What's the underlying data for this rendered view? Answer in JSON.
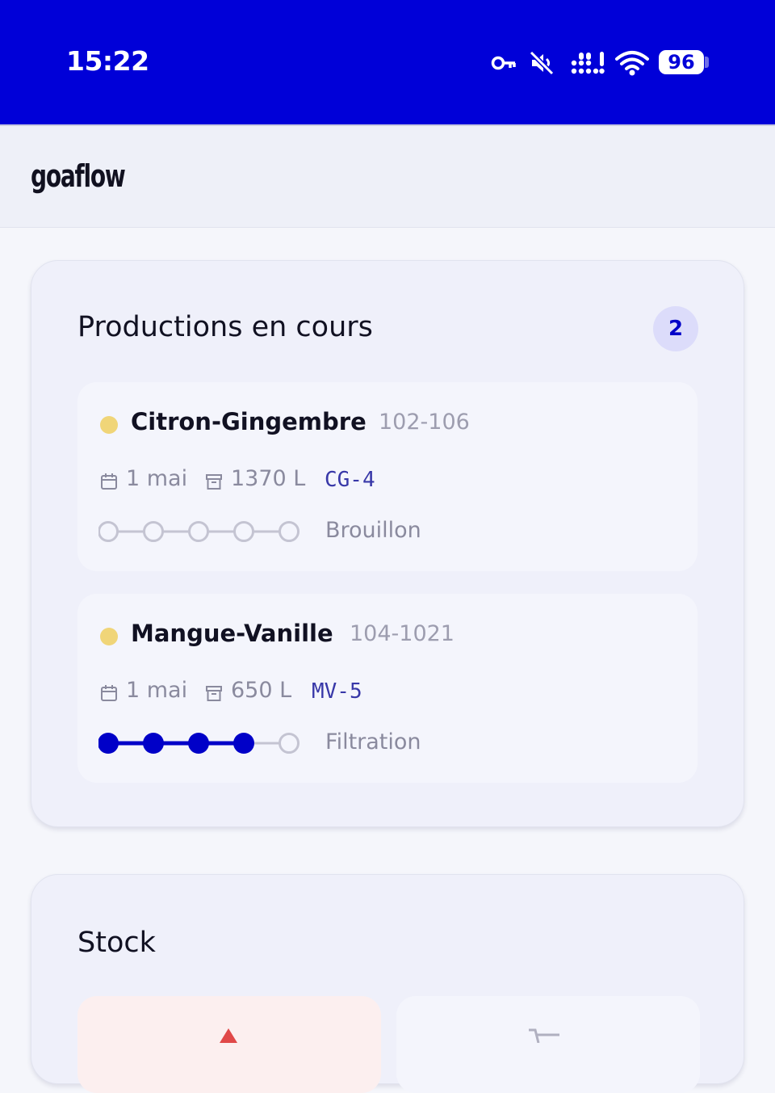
{
  "status_bar": {
    "time": "15:22",
    "battery": "96",
    "icons": [
      "vpn-key-icon",
      "mute-icon",
      "signal-icon",
      "wifi-icon",
      "battery-icon"
    ]
  },
  "app": {
    "name": "goaflow"
  },
  "productions": {
    "title": "Productions en cours",
    "count": "2",
    "items": [
      {
        "name": "Citron-Gingembre",
        "code": "102-106",
        "date": "1 mai",
        "volume": "1370 L",
        "ref": "CG-4",
        "steps_total": 5,
        "steps_done": 0,
        "status": "Brouillon",
        "dot_color": "#f0d578"
      },
      {
        "name": "Mangue-Vanille",
        "code": "104-1021",
        "date": "1 mai",
        "volume": "650 L",
        "ref": "MV-5",
        "steps_total": 5,
        "steps_done": 4,
        "status": "Filtration",
        "dot_color": "#f0d578"
      }
    ]
  },
  "stock": {
    "title": "Stock"
  },
  "colors": {
    "brand": "#0000d8",
    "step_done": "#0000c8",
    "step_todo": "#c4c4d2",
    "warning": "#e04848"
  }
}
